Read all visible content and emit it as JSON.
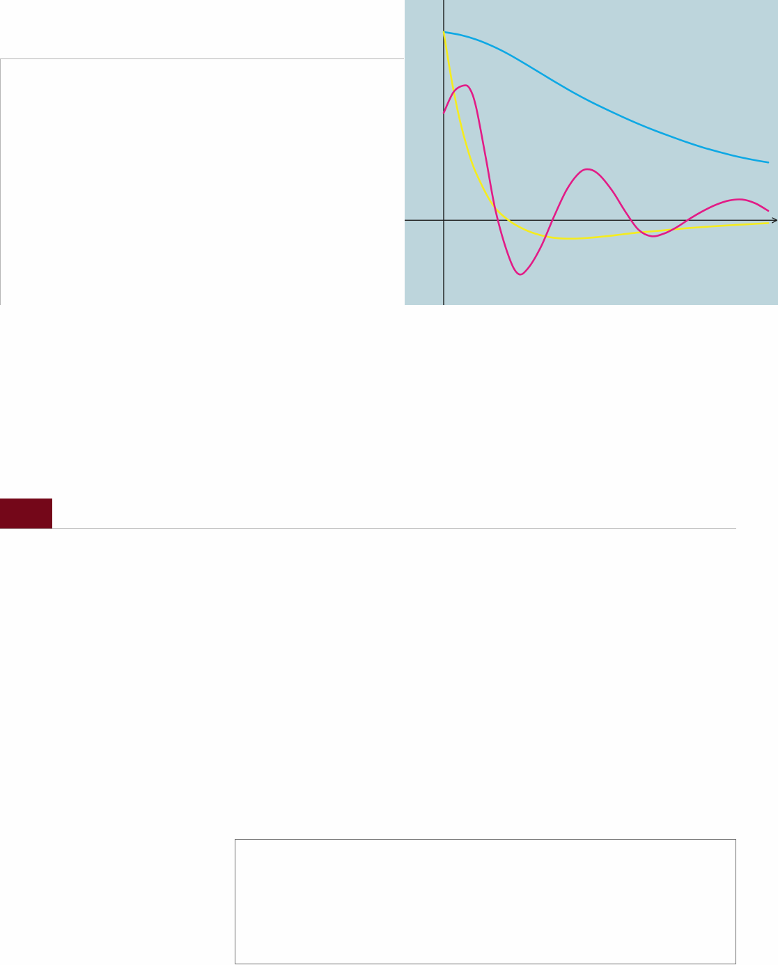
{
  "colors": {
    "panel_background": "#bdd5dc",
    "axis": "#1a1a1a",
    "section_marker": "#740719"
  },
  "chart_data": {
    "type": "line",
    "title": "",
    "xlabel": "",
    "ylabel": "",
    "xlim": [
      0,
      10
    ],
    "ylim": [
      -0.45,
      1.17
    ],
    "grid": false,
    "legend": "none",
    "series": [
      {
        "color": "#0ea8e4",
        "x": [
          0,
          0.5,
          1,
          1.5,
          2,
          2.5,
          3,
          3.5,
          4,
          4.5,
          5,
          5.5,
          6,
          6.5,
          7,
          7.5,
          8,
          8.5,
          9,
          9.5,
          10
        ],
        "y": [
          1.0,
          0.985,
          0.96,
          0.925,
          0.882,
          0.832,
          0.78,
          0.728,
          0.678,
          0.632,
          0.59,
          0.55,
          0.512,
          0.477,
          0.445,
          0.414,
          0.386,
          0.362,
          0.34,
          0.322,
          0.307
        ]
      },
      {
        "color": "#f5ec1e",
        "x": [
          0,
          0.25,
          0.5,
          0.75,
          1,
          1.5,
          2,
          2.5,
          3,
          3.5,
          4,
          4.5,
          5,
          5.5,
          6,
          6.5,
          7,
          7.5,
          8,
          8.5,
          9,
          9.5,
          10
        ],
        "y": [
          1.0,
          0.74,
          0.53,
          0.37,
          0.25,
          0.085,
          0.0,
          -0.05,
          -0.08,
          -0.095,
          -0.098,
          -0.093,
          -0.085,
          -0.075,
          -0.065,
          -0.058,
          -0.05,
          -0.042,
          -0.036,
          -0.03,
          -0.025,
          -0.02,
          -0.015
        ]
      },
      {
        "color": "#e21b86",
        "x": [
          0,
          0.3,
          0.6,
          0.8,
          1.0,
          1.3,
          1.6,
          2.0,
          2.3,
          2.6,
          3.0,
          3.4,
          3.8,
          4.2,
          4.5,
          4.8,
          5.2,
          5.6,
          6.0,
          6.4,
          6.8,
          7.2,
          7.6,
          8.0,
          8.4,
          8.8,
          9.2,
          9.6,
          10.0
        ],
        "y": [
          0.57,
          0.68,
          0.715,
          0.7,
          0.6,
          0.33,
          0.05,
          -0.19,
          -0.285,
          -0.255,
          -0.14,
          0.02,
          0.165,
          0.255,
          0.27,
          0.24,
          0.155,
          0.045,
          -0.05,
          -0.085,
          -0.07,
          -0.035,
          0.01,
          0.05,
          0.083,
          0.105,
          0.11,
          0.09,
          0.05
        ]
      }
    ]
  }
}
